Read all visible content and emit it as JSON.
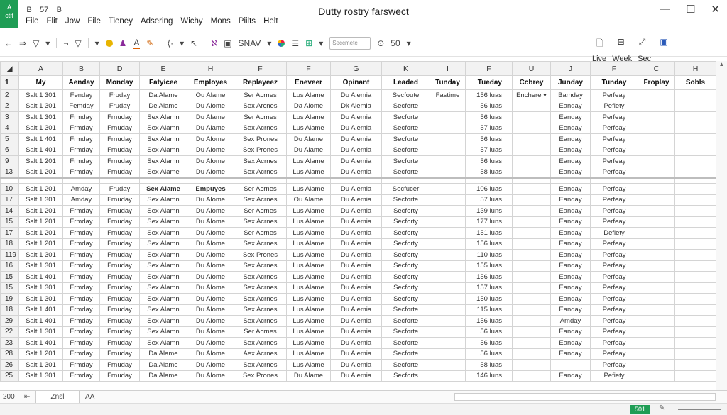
{
  "app": {
    "logo_text": "A\nctit",
    "title": "Dutty rostry farswect"
  },
  "quick_access": [
    "B",
    "57",
    "B"
  ],
  "window_controls": {
    "minimize": "—",
    "maximize": "☐",
    "close": "✕"
  },
  "menu": [
    "File",
    "Flit",
    "Jow",
    "File",
    "Tieney",
    "Adsering",
    "Wichy",
    "Mons",
    "Piilts",
    "Helt"
  ],
  "toolbar": {
    "back": "←",
    "forward": "⇒",
    "filter": "▽",
    "font_name": "SNAV",
    "font_box": "Seccmete",
    "zoom_label": "50",
    "view_tabs": [
      "Live",
      "Week",
      "Sec"
    ]
  },
  "columns": [
    "A",
    "B",
    "D",
    "E",
    "H",
    "F",
    "F",
    "G",
    "K",
    "I",
    "F",
    "U",
    "J",
    "F",
    "C",
    "H"
  ],
  "header_row": {
    "rownum": "1",
    "cells": [
      "My",
      "Aenday",
      "Monday",
      "Fatyicee",
      "Employes",
      "Replayeez",
      "Eneveer",
      "Opinant",
      "Leaded",
      "Tunday",
      "Tueday",
      "Ccbrey",
      "Junday",
      "Tunday",
      "Froplay",
      "Sobls"
    ]
  },
  "rows": [
    {
      "n": "2",
      "cells": [
        "Salt 1 301",
        "Fenday",
        "Fruday",
        "Da Alame",
        "Ou Alame",
        "Ser Acrnes",
        "Lus Alame",
        "Du Alemia",
        "Secfoute",
        "Fastime",
        "156 luas",
        "Enchere ▾",
        "Bamday",
        "Perfeay",
        "",
        ""
      ]
    },
    {
      "n": "2",
      "cells": [
        "Salt 1 301",
        "Femday",
        "Fruday",
        "De Alamo",
        "Du Alome",
        "Sex Arcnes",
        "Da Alome",
        "Dk Alemia",
        "Secferte",
        "",
        "56 luas",
        "",
        "Eanday",
        "Pefiety",
        "",
        ""
      ]
    },
    {
      "n": "3",
      "cells": [
        "Salt 1 301",
        "Frmday",
        "Frnuday",
        "Sex Alamn",
        "Du Alame",
        "Ser Acrnes",
        "Lus Alame",
        "Du Alemia",
        "Secforte",
        "",
        "56 luas",
        "",
        "Eanday",
        "Perfeay",
        "",
        ""
      ]
    },
    {
      "n": "4",
      "cells": [
        "Salt 1 301",
        "Frmday",
        "Frnuday",
        "Sex Alamn",
        "Du Alame",
        "Sex Acrnes",
        "Lus Alame",
        "Du Alemia",
        "Secforte",
        "",
        "57 luas",
        "",
        "Eenday",
        "Perfeay",
        "",
        ""
      ]
    },
    {
      "n": "5",
      "cells": [
        "Salt 1 401",
        "Frmday",
        "Frnuday",
        "Sex Alamn",
        "Du Alome",
        "Sex Prones",
        "Du Alame",
        "Du Alemia",
        "Secforte",
        "",
        "56 luas",
        "",
        "Eanday",
        "Perfeay",
        "",
        ""
      ]
    },
    {
      "n": "6",
      "cells": [
        "Salt 1 401",
        "Frmday",
        "Frnuday",
        "Sex Alamn",
        "Du Alome",
        "Sex Prones",
        "Du Alame",
        "Du Alemia",
        "Secforte",
        "",
        "57 luas",
        "",
        "Eanday",
        "Perfeay",
        "",
        ""
      ]
    },
    {
      "n": "9",
      "cells": [
        "Salt 1 201",
        "Frmday",
        "Frnuday",
        "Sex Alamn",
        "Du Alome",
        "Sex Acrnes",
        "Lus Alame",
        "Du Alemia",
        "Secforte",
        "",
        "56 luas",
        "",
        "Eanday",
        "Perfeay",
        "",
        ""
      ]
    },
    {
      "n": "13",
      "cells": [
        "Salt 1 201",
        "Frmday",
        "Frnuday",
        "Sex Alame",
        "Du Alome",
        "Sex Acrnes",
        "Lus Alame",
        "Du Alemia",
        "Secforte",
        "",
        "58 luas",
        "",
        "Eanday",
        "Perfeay",
        "",
        ""
      ]
    }
  ],
  "section2_header": {
    "n": "10",
    "cells": [
      "Salt 1 201",
      "Amday",
      "Fruday",
      "Sex Alame",
      "Empuyes",
      "Ser Acrnes",
      "Lus Alame",
      "Du Alemia",
      "Secfucer",
      "",
      "106 luas",
      "",
      "Eanday",
      "Perfeay",
      "",
      ""
    ]
  },
  "rows2": [
    {
      "n": "17",
      "cells": [
        "Salt 1 301",
        "Amday",
        "Frnuday",
        "Sex Alamn",
        "Du Alome",
        "Sex Acrnes",
        "Ou Alame",
        "Du Alemia",
        "Secforte",
        "",
        "57 luas",
        "",
        "Eanday",
        "Perfeay",
        "",
        ""
      ]
    },
    {
      "n": "14",
      "cells": [
        "Salt 1 201",
        "Frmday",
        "Frnuday",
        "Sex Alamn",
        "Du Alome",
        "Ser Acrnes",
        "Lus Alame",
        "Du Alemia",
        "Secforty",
        "",
        "139 luns",
        "",
        "Eanday",
        "Perfeay",
        "",
        ""
      ]
    },
    {
      "n": "15",
      "cells": [
        "Salt 1 201",
        "Frmday",
        "Frnuday",
        "Sex Alamn",
        "Du Alome",
        "Sex Acrnes",
        "Lus Alame",
        "Du Alemia",
        "Secforty",
        "",
        "177 luns",
        "",
        "Eanday",
        "Perfeay",
        "",
        ""
      ]
    },
    {
      "n": "17",
      "cells": [
        "Salt 1 201",
        "Frmday",
        "Frnuday",
        "Sex Alamn",
        "Du Alome",
        "Ser Acrnes",
        "Lus Alame",
        "Du Alemia",
        "Secforty",
        "",
        "151 luas",
        "",
        "Eanday",
        "Defiety",
        "",
        ""
      ]
    },
    {
      "n": "18",
      "cells": [
        "Salt 1 201",
        "Frmday",
        "Frnuday",
        "Sex Alamn",
        "Du Alome",
        "Sex Acrnes",
        "Lus Alame",
        "Du Alemia",
        "Secforty",
        "",
        "156 luas",
        "",
        "Eanday",
        "Perfeay",
        "",
        ""
      ]
    },
    {
      "n": "119",
      "cells": [
        "Salt 1 301",
        "Frmday",
        "Frnuday",
        "Sex Alamn",
        "Du Alome",
        "Sex Prones",
        "Lus Alame",
        "Du Alemia",
        "Secforty",
        "",
        "110 luas",
        "",
        "Eanday",
        "Perfeay",
        "",
        ""
      ]
    },
    {
      "n": "16",
      "cells": [
        "Salt 1 301",
        "Frmday",
        "Frnuday",
        "Sex Alamn",
        "Du Alome",
        "Sex Acrnes",
        "Lus Alame",
        "Du Alemia",
        "Secforty",
        "",
        "155 luas",
        "",
        "Eanday",
        "Perfeay",
        "",
        ""
      ]
    },
    {
      "n": "15",
      "cells": [
        "Salt 1 401",
        "Frmday",
        "Frnuday",
        "Sex Alamn",
        "Du Alome",
        "Sex Acrnes",
        "Lus Alame",
        "Du Alemia",
        "Secforty",
        "",
        "156 luas",
        "",
        "Eanday",
        "Perfeay",
        "",
        ""
      ]
    },
    {
      "n": "15",
      "cells": [
        "Salt 1 301",
        "Frmday",
        "Frnuday",
        "Sex Alamn",
        "Du Alome",
        "Sex Acrnes",
        "Lus Alame",
        "Du Alemia",
        "Secforty",
        "",
        "157 luas",
        "",
        "Eanday",
        "Perfeay",
        "",
        ""
      ]
    },
    {
      "n": "19",
      "cells": [
        "Salt 1 301",
        "Frmday",
        "Frnuday",
        "Sex Alamn",
        "Du Alome",
        "Sex Acrnes",
        "Lus Alame",
        "Du Alemia",
        "Secforty",
        "",
        "150 luas",
        "",
        "Eanday",
        "Perfeay",
        "",
        ""
      ]
    },
    {
      "n": "18",
      "cells": [
        "Salt 1 401",
        "Frmday",
        "Frnuday",
        "Sex Alamn",
        "Du Alome",
        "Sex Acrnes",
        "Lus Alame",
        "Du Alemia",
        "Secforte",
        "",
        "115 luas",
        "",
        "Eanday",
        "Perfeay",
        "",
        ""
      ]
    },
    {
      "n": "29",
      "cells": [
        "Salt 1 401",
        "Frmday",
        "Frnuday",
        "Sex Alamn",
        "Du Alome",
        "Sex Acrnes",
        "Lus Alame",
        "Du Alemia",
        "Secforte",
        "",
        "156 luas",
        "",
        "Amday",
        "Perfeay",
        "",
        ""
      ]
    },
    {
      "n": "22",
      "cells": [
        "Salt 1 301",
        "Frmday",
        "Frnuday",
        "Sex Alamn",
        "Du Alome",
        "Ser Acrnes",
        "Lus Alame",
        "Du Alemia",
        "Secforte",
        "",
        "56 luas",
        "",
        "Eanday",
        "Perfeay",
        "",
        ""
      ]
    },
    {
      "n": "23",
      "cells": [
        "Salt 1 401",
        "Frmday",
        "Frnuday",
        "Sex Alamn",
        "Du Alome",
        "Sex Acrnes",
        "Lus Alame",
        "Du Alemia",
        "Secforte",
        "",
        "56 luas",
        "",
        "Eanday",
        "Perfeay",
        "",
        ""
      ]
    },
    {
      "n": "28",
      "cells": [
        "Salt 1 201",
        "Frmday",
        "Frnuday",
        "Da Alame",
        "Du Alome",
        "Aex Acrnes",
        "Lus Alame",
        "Du Alemia",
        "Secforte",
        "",
        "56 luas",
        "",
        "Eanday",
        "Perfeay",
        "",
        ""
      ]
    },
    {
      "n": "26",
      "cells": [
        "Salt 1 301",
        "Frmday",
        "Frnuday",
        "Da Alame",
        "Du Alome",
        "Sex Acrnes",
        "Lus Alame",
        "Du Alemia",
        "Secforte",
        "",
        "58 luas",
        "",
        "",
        "Perfeay",
        "",
        ""
      ]
    },
    {
      "n": "25",
      "cells": [
        "Salt 1 301",
        "Frmday",
        "Frnuday",
        "Da Alame",
        "Du Alome",
        "Sex Prones",
        "Du Alame",
        "Du Alemia",
        "Secforts",
        "",
        "146 luns",
        "",
        "Eanday",
        "Pefiety",
        "",
        ""
      ]
    }
  ],
  "sheet_tabs": {
    "zoom": "200",
    "nav": "⇤",
    "active": "Znsl",
    "other": "AA"
  },
  "status": {
    "mode": "501"
  },
  "colors": {
    "accent": "#1f9d55"
  }
}
